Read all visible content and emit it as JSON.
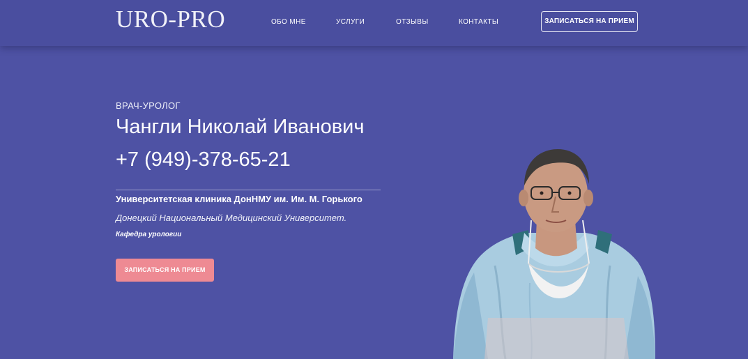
{
  "header": {
    "logo": "URO-PRO",
    "nav": [
      {
        "label": "ОБО МНЕ",
        "name": "nav-about"
      },
      {
        "label": "УСЛУГИ",
        "name": "nav-services"
      },
      {
        "label": "ОТЗЫВЫ",
        "name": "nav-reviews"
      },
      {
        "label": "КОНТАКТЫ",
        "name": "nav-contacts"
      }
    ],
    "cta_label": "ЗАПИСАТЬСЯ НА ПРИЕМ"
  },
  "hero": {
    "subtitle": "ВРАЧ-УРОЛОГ",
    "name": "Чангли Николай Иванович",
    "phone": "+7 (949)-378-65-21",
    "clinic": "Университетская клиника ДонНМУ им. Им. М. Горького",
    "university": "Донецкий Национальный Медицинский Университет.",
    "department": "Кафедра урологии",
    "cta_label": "ЗАПИСАТЬСЯ НА ПРИЕМ"
  },
  "colors": {
    "background": "#4e52a4",
    "header": "#4a4e9f",
    "cta_button": "#ee8a93",
    "text": "#ffffff"
  },
  "icons": {
    "photo": "doctor-portrait"
  }
}
